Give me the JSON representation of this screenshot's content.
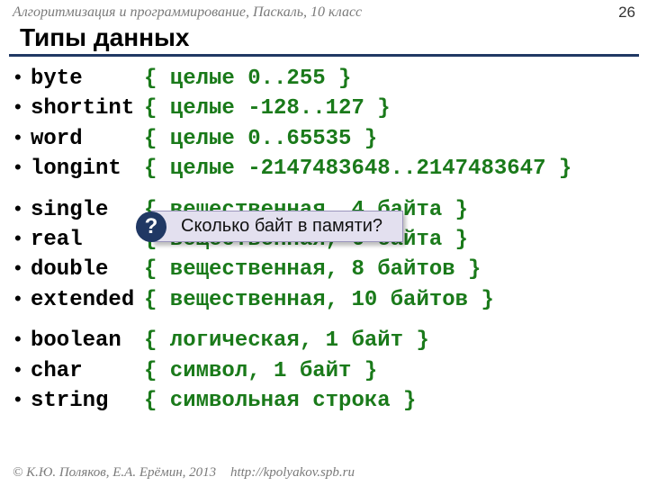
{
  "header": {
    "subject": "Алгоритмизация и программирование, Паскаль, 10 класс",
    "page": "26"
  },
  "title": "Типы данных",
  "bullet": "•",
  "groups": [
    [
      {
        "name": "byte",
        "comment": "{ целые 0..255 }"
      },
      {
        "name": "shortint",
        "comment": "{ целые -128..127 }"
      },
      {
        "name": "word",
        "comment": "{ целые 0..65535 }"
      },
      {
        "name": "longint",
        "comment": "{ целые -2147483648..2147483647 }"
      }
    ],
    [
      {
        "name": "single",
        "comment": "{ вещественная, 4 байта }"
      },
      {
        "name": "real",
        "comment": "{ вещественная, 6 байта }"
      },
      {
        "name": "double",
        "comment": "{ вещественная, 8 байтов }"
      },
      {
        "name": "extended",
        "comment": "{ вещественная, 10 байтов }"
      }
    ],
    [
      {
        "name": "boolean",
        "comment": "{ логическая, 1 байт }"
      },
      {
        "name": "char",
        "comment": "{ символ, 1 байт }"
      },
      {
        "name": "string",
        "comment": "{ символьная строка }"
      }
    ]
  ],
  "popup": {
    "icon": "?",
    "text": "Сколько байт в памяти?"
  },
  "footer": {
    "copyright": "© К.Ю. Поляков, Е.А. Ерёмин, 2013",
    "url": "http://kpolyakov.spb.ru"
  }
}
